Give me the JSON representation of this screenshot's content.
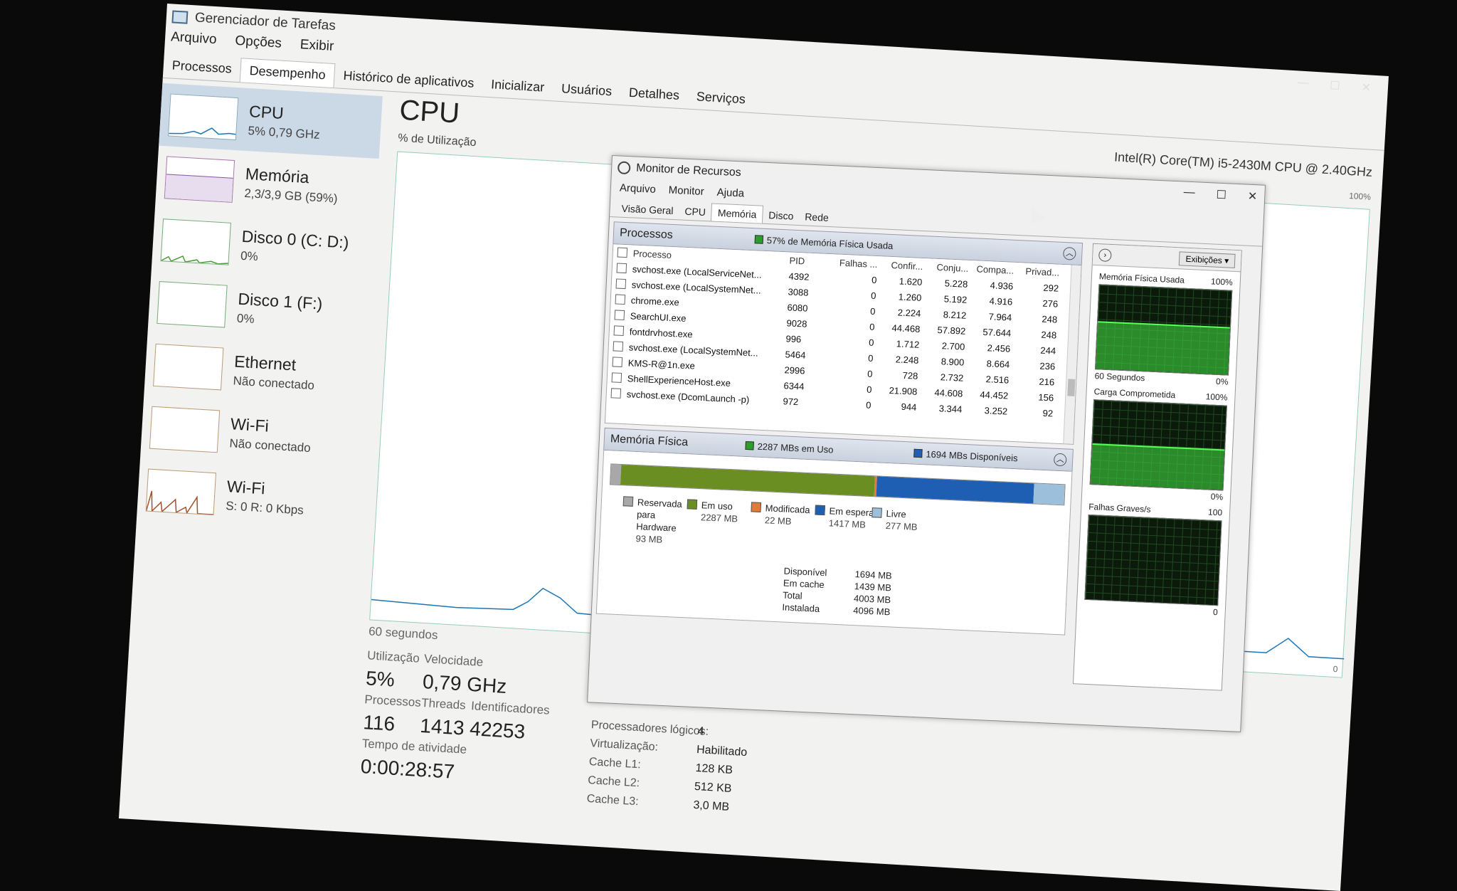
{
  "task_manager": {
    "title": "Gerenciador de Tarefas",
    "menu": [
      "Arquivo",
      "Opções",
      "Exibir"
    ],
    "tabs": [
      "Processos",
      "Desempenho",
      "Histórico de aplicativos",
      "Inicializar",
      "Usuários",
      "Detalhes",
      "Serviços"
    ],
    "active_tab": "Desempenho",
    "sidebar": [
      {
        "name": "CPU",
        "value": "5% 0,79 GHz"
      },
      {
        "name": "Memória",
        "value": "2,3/3,9 GB (59%)"
      },
      {
        "name": "Disco 0 (C: D:)",
        "value": "0%"
      },
      {
        "name": "Disco 1 (F:)",
        "value": "0%"
      },
      {
        "name": "Ethernet",
        "value": "Não conectado"
      },
      {
        "name": "Wi-Fi",
        "value": "Não conectado"
      },
      {
        "name": "Wi-Fi",
        "value": "S: 0 R: 0 Kbps"
      }
    ],
    "main": {
      "title": "CPU",
      "cpu_model": "Intel(R) Core(TM) i5-2430M CPU @ 2.40GHz",
      "util_label": "% de Utilização",
      "pct_max": "100%",
      "time_label": "60 segundos",
      "zero": "0",
      "stats": {
        "util_label": "Utilização",
        "util": "5%",
        "speed_label": "Velocidade",
        "speed": "0,79 GHz",
        "proc_label": "Processos",
        "proc": "116",
        "threads_label": "Threads",
        "threads": "1413",
        "handles_label": "Identificadores",
        "handles": "42253",
        "uptime_label": "Tempo de atividade",
        "uptime": "0:00:28:57"
      },
      "info": [
        {
          "k": "Processadores lógicos:",
          "v": "4"
        },
        {
          "k": "Virtualização:",
          "v": "Habilitado"
        },
        {
          "k": "Cache L1:",
          "v": "128 KB"
        },
        {
          "k": "Cache L2:",
          "v": "512 KB"
        },
        {
          "k": "Cache L3:",
          "v": "3,0 MB"
        }
      ]
    }
  },
  "resource_monitor": {
    "title": "Monitor de Recursos",
    "menu": [
      "Arquivo",
      "Monitor",
      "Ajuda"
    ],
    "tabs": [
      "Visão Geral",
      "CPU",
      "Memória",
      "Disco",
      "Rede"
    ],
    "active_tab": "Memória",
    "processes": {
      "title": "Processos",
      "badge": "57% de Memória Física Usada",
      "badge_color": "#2a9d2a",
      "columns": [
        "Processo",
        "PID",
        "Falhas ...",
        "Confir...",
        "Conju...",
        "Compa...",
        "Privad..."
      ],
      "rows": [
        [
          "svchost.exe (LocalServiceNet...",
          "4392",
          "0",
          "1.620",
          "5.228",
          "4.936",
          "292"
        ],
        [
          "svchost.exe (LocalSystemNet...",
          "3088",
          "0",
          "1.260",
          "5.192",
          "4.916",
          "276"
        ],
        [
          "chrome.exe",
          "6080",
          "0",
          "2.224",
          "8.212",
          "7.964",
          "248"
        ],
        [
          "SearchUI.exe",
          "9028",
          "0",
          "44.468",
          "57.892",
          "57.644",
          "248"
        ],
        [
          "fontdrvhost.exe",
          "996",
          "0",
          "1.712",
          "2.700",
          "2.456",
          "244"
        ],
        [
          "svchost.exe (LocalSystemNet...",
          "5464",
          "0",
          "2.248",
          "8.900",
          "8.664",
          "236"
        ],
        [
          "KMS-R@1n.exe",
          "2996",
          "0",
          "728",
          "2.732",
          "2.516",
          "216"
        ],
        [
          "ShellExperienceHost.exe",
          "6344",
          "0",
          "21.908",
          "44.608",
          "44.452",
          "156"
        ],
        [
          "svchost.exe (DcomLaunch -p)",
          "972",
          "0",
          "944",
          "3.344",
          "3.252",
          "92"
        ]
      ]
    },
    "physical_memory": {
      "title": "Memória Física",
      "in_use_badge": "2287 MBs em Uso",
      "available_badge": "1694 MBs Disponíveis",
      "legend": [
        {
          "label": "Reservada para Hardware",
          "value": "93 MB",
          "color": "#a8a8a8",
          "mb": 93
        },
        {
          "label": "Em uso",
          "value": "2287 MB",
          "color": "#6b8e23",
          "mb": 2287
        },
        {
          "label": "Modificada",
          "value": "22 MB",
          "color": "#e07b39",
          "mb": 22
        },
        {
          "label": "Em espera",
          "value": "1417 MB",
          "color": "#1e5fb4",
          "mb": 1417
        },
        {
          "label": "Livre",
          "value": "277 MB",
          "color": "#9cc0dc",
          "mb": 277
        }
      ],
      "summary": [
        {
          "k": "Disponível",
          "v": "1694 MB"
        },
        {
          "k": "Em cache",
          "v": "1439 MB"
        },
        {
          "k": "Total",
          "v": "4003 MB"
        },
        {
          "k": "Instalada",
          "v": "4096 MB"
        }
      ]
    },
    "right_panel": {
      "views_button": "Exibições",
      "graphs": [
        {
          "title": "Memória Física Usada",
          "max": "100%",
          "sub_left": "60 Segundos",
          "sub_right": "0%"
        },
        {
          "title": "Carga Comprometida",
          "max": "100%",
          "sub_left": "",
          "sub_right": "0%"
        },
        {
          "title": "Falhas Graves/s",
          "max": "100",
          "sub_left": "",
          "sub_right": "0"
        }
      ]
    }
  }
}
